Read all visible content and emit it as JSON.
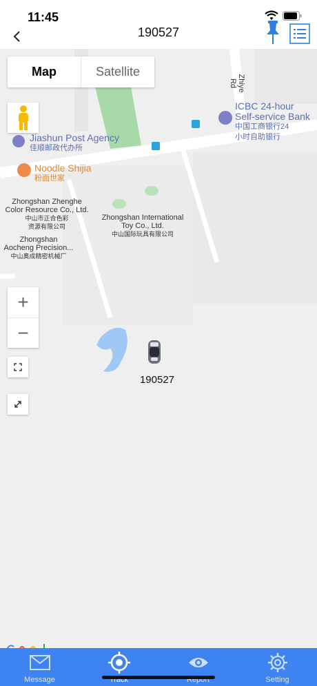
{
  "status": {
    "time": "11:45"
  },
  "nav": {
    "title": "190527"
  },
  "map": {
    "map_label": "Map",
    "satellite_label": "Satellite",
    "zoom_in": "+",
    "zoom_out": "−",
    "labels": {
      "street": "Zhiye Rd",
      "icbc_en1": "ICBC 24-hour",
      "icbc_en2": "Self-service Bank",
      "icbc_zh1": "中国工商银行24",
      "icbc_zh2": "小时自助银行",
      "post_en": "Jiashun Post Agency",
      "post_zh": "佳顺邮政代办所",
      "noodle_en": "Noodle Shijia",
      "noodle_zh": "粉面世家",
      "zhenghe_en1": "Zhongshan Zhenghe",
      "zhenghe_en2": "Color Resource Co., Ltd.",
      "zhenghe_zh1": "中山市正合色彩",
      "zhenghe_zh2": "资源有限公司",
      "toy_en1": "Zhongshan International",
      "toy_en2": "Toy Co., Ltd.",
      "toy_zh": "中山国际玩具有限公司",
      "aocheng_en1": "Zhongshan",
      "aocheng_en2": "Aocheng Precision...",
      "aocheng_zh": "中山奥成精密机械厂"
    },
    "vehicle": {
      "label": "190527"
    }
  },
  "tabs": [
    {
      "label": "Message",
      "icon": "envelope-icon"
    },
    {
      "label": "Track",
      "icon": "target-icon"
    },
    {
      "label": "Report",
      "icon": "eye-icon"
    },
    {
      "label": "Setting",
      "icon": "gear-icon"
    }
  ],
  "colors": {
    "accent": "#3e83f2",
    "pin": "#2f7fe0",
    "map_bg": "#efefef",
    "park": "#a8d9a8",
    "water": "#9fc8f5"
  }
}
